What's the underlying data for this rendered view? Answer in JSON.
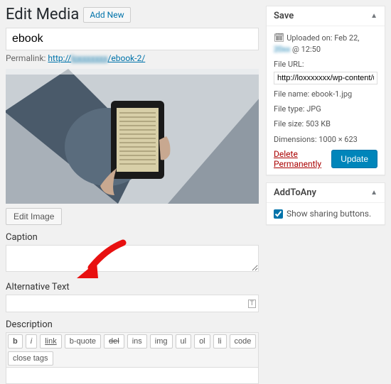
{
  "heading": "Edit Media",
  "add_new": "Add New",
  "title_value": "ebook",
  "permalink": {
    "label": "Permalink:",
    "url_prefix": "http://",
    "url_blur": "loxxxxxxx",
    "url_suffix": "/ebook-2/"
  },
  "edit_image": "Edit Image",
  "fields": {
    "caption_label": "Caption",
    "caption_value": "",
    "alt_label": "Alternative Text",
    "alt_value": "",
    "desc_label": "Description"
  },
  "quicktags": [
    "b",
    "i",
    "link",
    "b-quote",
    "del",
    "ins",
    "img",
    "ul",
    "ol",
    "li",
    "code",
    "close tags"
  ],
  "save_box": {
    "title": "Save",
    "uploaded_label": "Uploaded on:",
    "uploaded_value": "Feb 22,",
    "uploaded_year_blur": "20xx",
    "uploaded_time": "@ 12:50",
    "file_url_label": "File URL:",
    "file_url_value": "http://loxxxxxxx/wp-content/uploads",
    "file_name_label": "File name:",
    "file_name_value": "ebook-1.jpg",
    "file_type_label": "File type:",
    "file_type_value": "JPG",
    "file_size_label": "File size:",
    "file_size_value": "503 KB",
    "dimensions_label": "Dimensions:",
    "dimensions_value": "1000 × 623",
    "delete": "Delete Permanently",
    "update": "Update"
  },
  "addtoany": {
    "title": "AddToAny",
    "checkbox_label": "Show sharing buttons.",
    "checked": true
  }
}
